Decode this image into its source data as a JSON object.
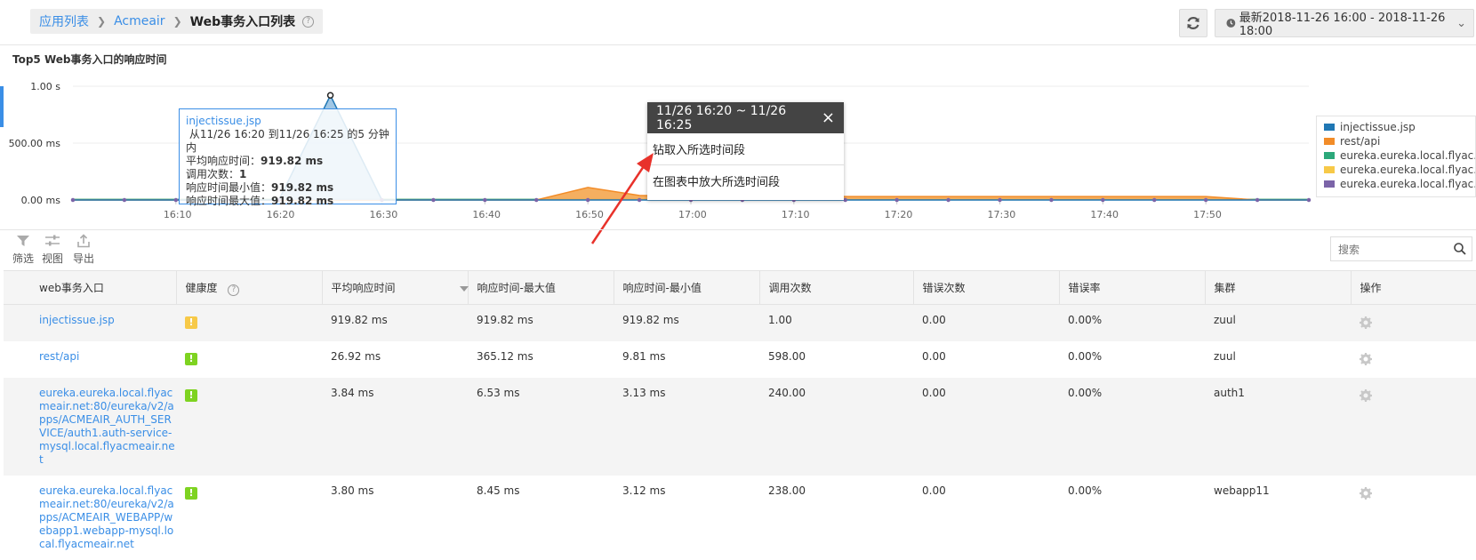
{
  "header": {
    "breadcrumb": [
      "应用列表",
      "Acmeair",
      "Web事务入口列表"
    ],
    "help_symbol": "?",
    "refresh_icon": "refresh-icon",
    "time_range": "最新2018-11-26 16:00 - 2018-11-26 18:00"
  },
  "chart_section": {
    "title": "Top5 Web事务入口的响应时间"
  },
  "chart_data": {
    "type": "area",
    "title": "Top5 Web事务入口的响应时间",
    "xlabel": "",
    "ylabel": "",
    "y_ticks": [
      "1.00 s",
      "500.00 ms",
      "0.00 ms"
    ],
    "ylim": [
      0,
      1000
    ],
    "y_unit": "ms",
    "x_ticks": [
      "16:10",
      "16:20",
      "16:30",
      "16:40",
      "16:50",
      "17:00",
      "17:10",
      "17:20",
      "17:30",
      "17:40",
      "17:50"
    ],
    "x": [
      "16:00",
      "16:05",
      "16:10",
      "16:15",
      "16:20",
      "16:25",
      "16:30",
      "16:35",
      "16:40",
      "16:45",
      "16:50",
      "16:55",
      "17:00",
      "17:05",
      "17:10",
      "17:15",
      "17:20",
      "17:25",
      "17:30",
      "17:35",
      "17:40",
      "17:45",
      "17:50",
      "17:55",
      "18:00"
    ],
    "series": [
      {
        "name": "injectissue.jsp",
        "color": "#1f77b4",
        "fill": "#8fbde0",
        "values": [
          0,
          0,
          0,
          0,
          0,
          919.82,
          0,
          0,
          0,
          0,
          0,
          0,
          0,
          0,
          0,
          0,
          0,
          0,
          0,
          0,
          0,
          0,
          0,
          0,
          0
        ]
      },
      {
        "name": "rest/api",
        "color": "#f28c28",
        "fill": "#f4a64f",
        "values": [
          0,
          0,
          0,
          0,
          0,
          0,
          0,
          0,
          0,
          0,
          110,
          40,
          30,
          30,
          30,
          30,
          30,
          30,
          30,
          30,
          30,
          30,
          30,
          0,
          0
        ]
      },
      {
        "name": "eureka.eureka.local.flyac...",
        "color": "#2ca87a",
        "values": [
          5,
          5,
          5,
          5,
          5,
          5,
          5,
          5,
          5,
          5,
          5,
          5,
          5,
          5,
          5,
          5,
          5,
          5,
          5,
          5,
          5,
          5,
          5,
          5,
          5
        ]
      },
      {
        "name": "eureka.eureka.local.flyac...",
        "color": "#f7c948",
        "values": [
          4,
          4,
          4,
          4,
          4,
          4,
          4,
          4,
          4,
          4,
          4,
          4,
          4,
          4,
          4,
          4,
          4,
          4,
          4,
          4,
          4,
          4,
          4,
          4,
          4
        ]
      },
      {
        "name": "eureka.eureka.local.flyac...",
        "color": "#7b64a8",
        "values": [
          3,
          3,
          3,
          3,
          3,
          3,
          3,
          3,
          3,
          3,
          3,
          3,
          3,
          3,
          3,
          3,
          3,
          3,
          3,
          3,
          3,
          3,
          3,
          3,
          3
        ]
      }
    ],
    "grid": true,
    "legend": "right"
  },
  "chart_tooltip": {
    "title": "injectissue.jsp",
    "line1": "从11/26 16:20 到11/26 16:25 的5 分钟内",
    "avg_label": "平均响应时间：",
    "avg_value": "919.82 ms",
    "calls_label": "调用次数：",
    "calls_value": "1",
    "min_label": "响应时间最小值：",
    "min_value": "919.82 ms",
    "max_label": "响应时间最大值：",
    "max_value": "919.82 ms"
  },
  "popup": {
    "title": "11/26 16:20 ~ 11/26 16:25",
    "close": "×",
    "items": [
      "钻取入所选时间段",
      "在图表中放大所选时间段"
    ]
  },
  "toolbar": {
    "filter": "筛选",
    "view": "视图",
    "export": "导出",
    "search_placeholder": "搜索"
  },
  "table": {
    "columns": [
      "web事务入口",
      "健康度",
      "平均响应时间",
      "响应时间-最大值",
      "响应时间-最小值",
      "调用次数",
      "错误次数",
      "错误率",
      "集群",
      "操作"
    ],
    "rows": [
      {
        "entry": "injectissue.jsp",
        "health": "!",
        "health_color": "#f7c948",
        "avg": "919.82 ms",
        "max": "919.82 ms",
        "min": "919.82 ms",
        "calls": "1.00",
        "errors": "0.00",
        "error_rate": "0.00%",
        "cluster": "zuul"
      },
      {
        "entry": "rest/api",
        "health": "!",
        "health_color": "#7ed321",
        "avg": "26.92 ms",
        "max": "365.12 ms",
        "min": "9.81 ms",
        "calls": "598.00",
        "errors": "0.00",
        "error_rate": "0.00%",
        "cluster": "zuul"
      },
      {
        "entry": "eureka.eureka.local.flyacmeair.net:80/eureka/v2/apps/ACMEAIR_AUTH_SERVICE/auth1.auth-service-mysql.local.flyacmeair.net",
        "health": "!",
        "health_color": "#7ed321",
        "avg": "3.84 ms",
        "max": "6.53 ms",
        "min": "3.13 ms",
        "calls": "240.00",
        "errors": "0.00",
        "error_rate": "0.00%",
        "cluster": "auth1"
      },
      {
        "entry": "eureka.eureka.local.flyacmeair.net:80/eureka/v2/apps/ACMEAIR_WEBAPP/webapp1.webapp-mysql.local.flyacmeair.net",
        "health": "!",
        "health_color": "#7ed321",
        "avg": "3.80 ms",
        "max": "8.45 ms",
        "min": "3.12 ms",
        "calls": "238.00",
        "errors": "0.00",
        "error_rate": "0.00%",
        "cluster": "webapp11"
      }
    ]
  }
}
